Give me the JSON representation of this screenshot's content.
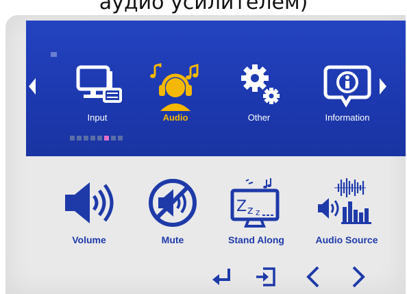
{
  "caption": "аудио усилителем)",
  "colors": {
    "menu_bar": "#1e3cb0",
    "active_item": "#f5b800",
    "icon_blue": "#1e3aa8",
    "panel_bg": "#e9e9ea",
    "pager_active": "#e26ec9"
  },
  "top_menu": {
    "items": [
      {
        "label": "Input",
        "icon": "monitor-keyboard-icon",
        "active": false
      },
      {
        "label": "Audio",
        "icon": "headphones-person-icon",
        "active": true
      },
      {
        "label": "Other",
        "icon": "gears-icon",
        "active": false
      },
      {
        "label": "Information",
        "icon": "info-icon",
        "active": false
      }
    ],
    "pager": {
      "count": 8,
      "active_index": 5
    }
  },
  "audio_menu": {
    "items": [
      {
        "label": "Volume",
        "icon": "speaker-volume-icon"
      },
      {
        "label": "Mute",
        "icon": "mute-icon"
      },
      {
        "label": "Stand Along",
        "icon": "sleep-monitor-icon"
      },
      {
        "label": "Audio Source",
        "icon": "audio-source-icon"
      }
    ]
  },
  "nav_keys": [
    {
      "name": "enter-icon"
    },
    {
      "name": "exit-icon"
    },
    {
      "name": "left-icon"
    },
    {
      "name": "right-icon"
    }
  ]
}
